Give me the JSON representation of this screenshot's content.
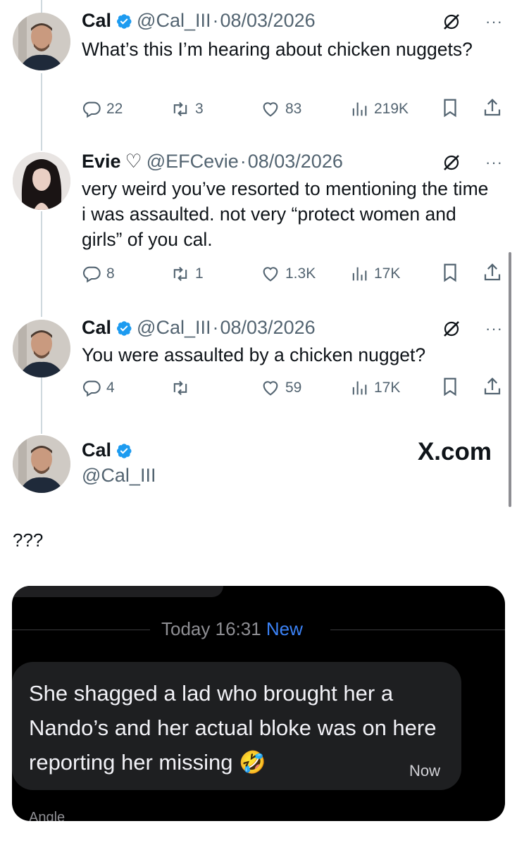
{
  "tweets": [
    {
      "name": "Cal",
      "handle": "@Cal_III",
      "date": "08/03/2026",
      "text": "What’s this I’m hearing about chicken nuggets?",
      "replies": "22",
      "retweets": "3",
      "likes": "83",
      "views": "219K"
    },
    {
      "name": "Evie",
      "name_emoji": "♡",
      "handle": "@EFCevie",
      "date": "08/03/2026",
      "text": "very weird you’ve resorted to mentioning the time i was assaulted. not very “protect women and girls” of you cal.",
      "replies": "8",
      "retweets": "1",
      "likes": "1.3K",
      "views": "17K"
    },
    {
      "name": "Cal",
      "handle": "@Cal_III",
      "date": "08/03/2026",
      "text": "You were assaulted by a chicken nugget?",
      "replies": "4",
      "retweets": "",
      "likes": "59",
      "views": "17K"
    }
  ],
  "profile_card": {
    "name": "Cal",
    "handle": "@Cal_III",
    "brand": "X.com"
  },
  "caption": "???",
  "dm": {
    "timestamp": "Today 16:31",
    "new_label": "New",
    "message": "She shagged a lad who brought her a Nando’s and her actual bloke was on here reporting her missing",
    "emoji": "🤣",
    "time": "Now",
    "truncated_label": "Angle"
  },
  "colors": {
    "verified": "#1d9bf0",
    "muted": "#536471",
    "new_blue": "#3b82f6",
    "bubble": "#1e1f21"
  },
  "separator": "·",
  "more_label": "···"
}
